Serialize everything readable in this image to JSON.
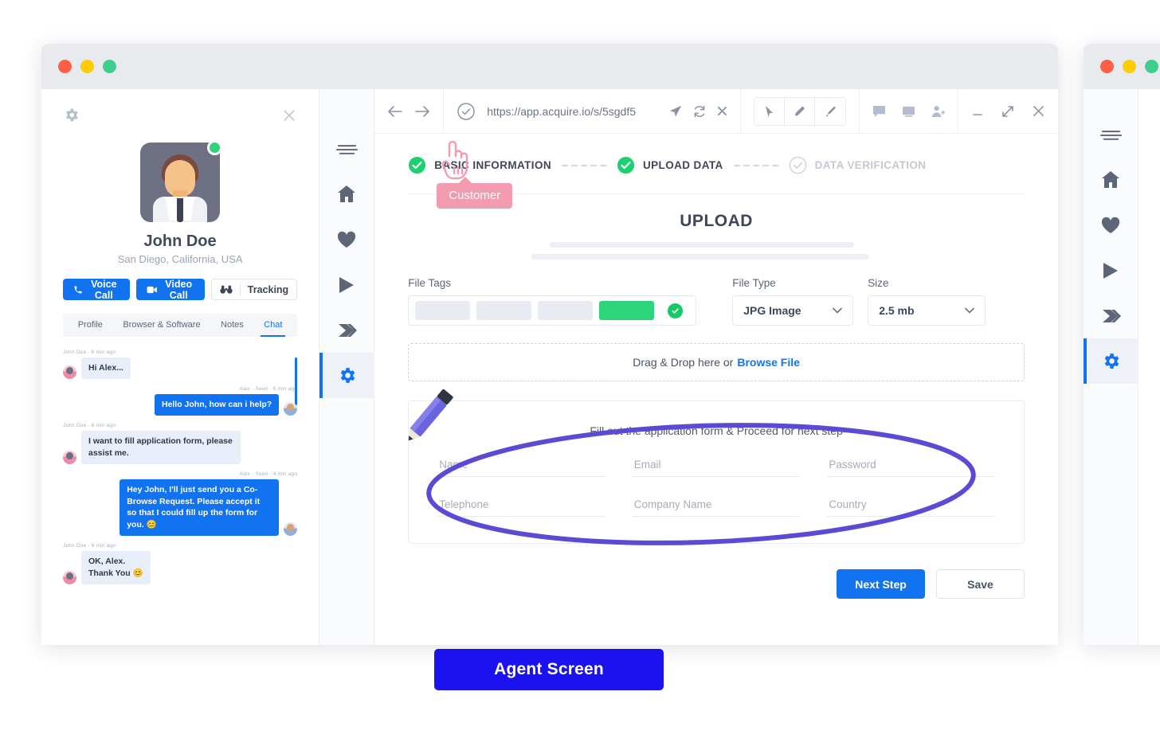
{
  "window_controls": {
    "close": "close",
    "minimize": "minimize",
    "maximize": "maximize"
  },
  "customer_panel": {
    "settings_icon": "gear-icon",
    "close_icon": "close-icon",
    "avatar_alt": "customer-avatar",
    "status": "online",
    "name": "John Doe",
    "location": "San Diego, California, USA",
    "actions": [
      {
        "label": "Voice Call",
        "icon": "phone-icon",
        "style": "primary"
      },
      {
        "label": "Video Call",
        "icon": "video-icon",
        "style": "primary"
      },
      {
        "label": "Tracking",
        "icon": "binoculars-icon",
        "style": "outline"
      }
    ],
    "tabs": [
      {
        "label": "Profile",
        "active": false
      },
      {
        "label": "Browser & Software",
        "active": false
      },
      {
        "label": "Notes",
        "active": false
      },
      {
        "label": "Chat",
        "active": true
      }
    ],
    "messages": [
      {
        "meta": "John Doe - 6 min ago",
        "text": "Hi Alex...",
        "side": "in"
      },
      {
        "meta": "Alex · Seen · 6 min ago",
        "text": "Hello John, how can i help?",
        "side": "out"
      },
      {
        "meta": "John Doe - 6 min ago",
        "text": "I want to fill application form, please assist me.",
        "side": "in"
      },
      {
        "meta": "Alex · Seen · 4 min ago",
        "text": "Hey John, I'll just send you a Co-Browse Request. Please accept it so that I could fill up the form for you. 😊",
        "side": "out"
      },
      {
        "meta": "John Doe - 6 min ago",
        "text": "OK, Alex.\nThank You 😊",
        "side": "in"
      }
    ]
  },
  "nav_rail": {
    "items": [
      {
        "icon": "menu-icon",
        "active": false
      },
      {
        "icon": "home-icon",
        "active": false
      },
      {
        "icon": "heart-icon",
        "active": false
      },
      {
        "icon": "play-icon",
        "active": false
      },
      {
        "icon": "tag-icon",
        "active": false
      },
      {
        "icon": "gear-icon",
        "active": true
      }
    ]
  },
  "browser": {
    "back_icon": "arrow-left-icon",
    "forward_icon": "arrow-right-icon",
    "secure_icon": "verified-check-icon",
    "url": "https://app.acquire.io/s/5sgdf5",
    "share_icon": "send-icon",
    "reload_icon": "refresh-icon",
    "stop_icon": "close-icon",
    "tools": [
      {
        "icon": "cursor-arrow-icon"
      },
      {
        "icon": "pencil-icon"
      },
      {
        "icon": "brush-icon"
      }
    ],
    "right_icons": [
      {
        "icon": "chat-bubble-icon"
      },
      {
        "icon": "screen-share-icon"
      },
      {
        "icon": "add-person-icon"
      },
      {
        "icon": "minimize-icon"
      },
      {
        "icon": "expand-icon"
      },
      {
        "icon": "close-icon"
      }
    ]
  },
  "stepper": [
    {
      "label": "BASIC INFORMATION",
      "state": "done"
    },
    {
      "label": "UPLOAD DATA",
      "state": "done"
    },
    {
      "label": "DATA VERIFICATION",
      "state": "pending"
    }
  ],
  "upload": {
    "title": "UPLOAD",
    "cursor_label": "Customer",
    "file_tags_label": "File Tags",
    "file_type_label": "File Type",
    "file_type_value": "JPG Image",
    "size_label": "Size",
    "size_value": "2.5 mb",
    "dropzone_text": "Drag & Drop here or",
    "dropzone_link": "Browse File",
    "tag_chips": [
      "",
      "",
      "",
      "selected"
    ],
    "validated_icon": "check-circle-icon"
  },
  "form": {
    "hint": "Fill out the application form & Proceed for next step",
    "pencil_icon": "pencil-illustration-icon",
    "fields": [
      {
        "placeholder": "Name",
        "value": ""
      },
      {
        "placeholder": "Email",
        "value": ""
      },
      {
        "placeholder": "Password",
        "value": ""
      },
      {
        "placeholder": "Telephone",
        "value": ""
      },
      {
        "placeholder": "Company Name",
        "value": ""
      },
      {
        "placeholder": "Country",
        "value": ""
      }
    ]
  },
  "actions": {
    "next_label": "Next Step",
    "save_label": "Save"
  },
  "banner": {
    "label": "Agent Screen"
  },
  "colors": {
    "primary_blue": "#1273f0",
    "banner_blue": "#1b13ef",
    "green": "#2ed47a",
    "pink": "#f39bb0",
    "ellipse_purple": "#5b4bd4"
  }
}
